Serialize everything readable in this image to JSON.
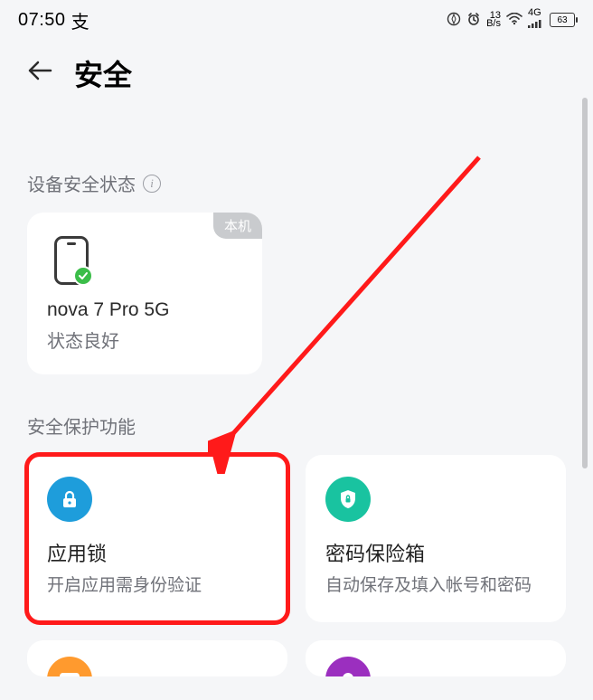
{
  "status": {
    "time": "07:50",
    "bs_top": "13",
    "bs_bot": "B/s",
    "net": "4G",
    "battery": "63"
  },
  "header": {
    "title": "安全"
  },
  "device_section": {
    "label": "设备安全状态",
    "badge": "本机",
    "name": "nova 7 Pro 5G",
    "status": "状态良好"
  },
  "protect_section": {
    "label": "安全保护功能",
    "cards": [
      {
        "title": "应用锁",
        "desc": "开启应用需身份验证"
      },
      {
        "title": "密码保险箱",
        "desc": "自动保存及填入帐号和密码"
      }
    ]
  }
}
